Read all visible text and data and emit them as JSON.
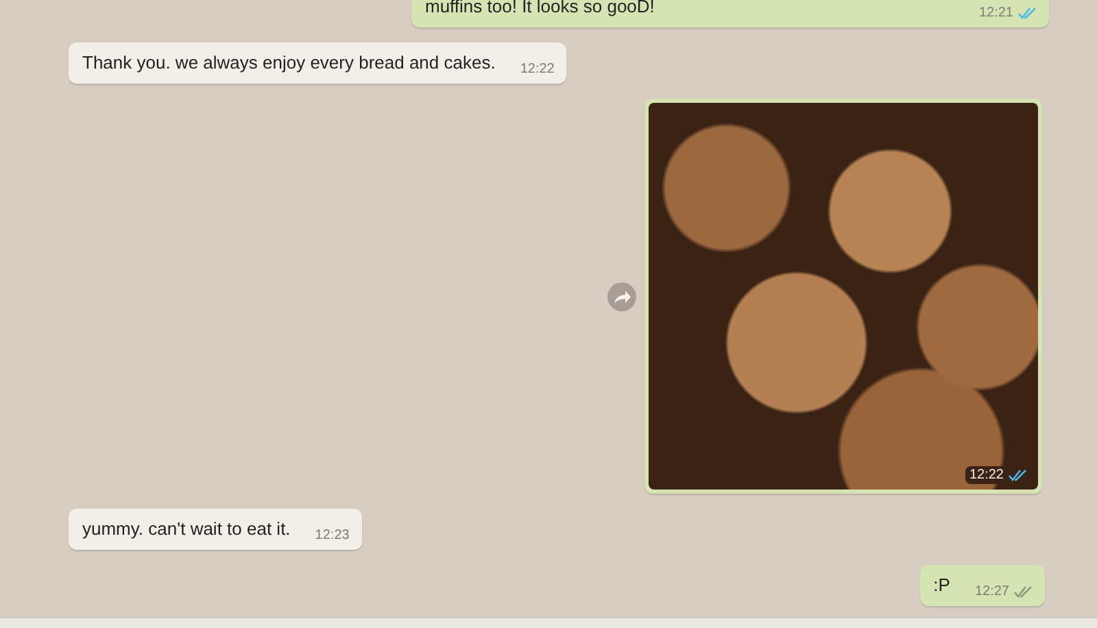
{
  "messages": [
    {
      "kind": "text",
      "outgoing": true,
      "text": "muffins too! It looks so gooD!",
      "time": "12:21",
      "read": true
    },
    {
      "kind": "text",
      "outgoing": false,
      "text": "Thank you. we always enjoy every bread and cakes.",
      "time": "12:22"
    },
    {
      "kind": "image",
      "outgoing": true,
      "time": "12:22",
      "read": true,
      "forward": true
    },
    {
      "kind": "text",
      "outgoing": false,
      "text": "yummy. can't wait to eat it.",
      "time": "12:23"
    },
    {
      "kind": "text",
      "outgoing": true,
      "text": ":P",
      "time": "12:27",
      "read": false
    }
  ]
}
